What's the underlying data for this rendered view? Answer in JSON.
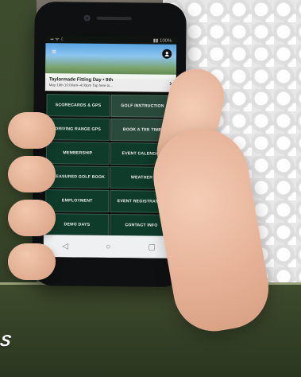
{
  "phone_screen": {
    "status_bar": {
      "left": "•• ᯤ ☾",
      "right": "▮▮ 100%"
    },
    "promo": {
      "title": "Taylormade Fitting Day • 9th",
      "subtitle": "May 19th 10:00am–4:00pm Tap here to...",
      "arrow": "›"
    },
    "tiles": [
      {
        "label": "SCORECARDS & GPS"
      },
      {
        "label": "GOLF INSTRUCTION"
      },
      {
        "label": "DRIVING RANGE GPS"
      },
      {
        "label": "BOOK A TEE TIME"
      },
      {
        "label": "MEMBERSHIP"
      },
      {
        "label": "EVENT CALENDAR"
      },
      {
        "label": "TREASURED GOLF BOOK"
      },
      {
        "label": "WEATHER"
      },
      {
        "label": "EMPLOYMENT"
      },
      {
        "label": "EVENT REGISTRATION"
      },
      {
        "label": "DEMO DAYS"
      },
      {
        "label": "CONTACT INFO"
      }
    ],
    "nav_icons": [
      "back-icon",
      "home-icon",
      "recent-apps-icon"
    ]
  },
  "background_text": {
    "logo_fragment": "S"
  },
  "colors": {
    "tile_green": "#0f3b2b",
    "screen_black": "#0d0f0d",
    "golfball_white": "#e8e8e8",
    "bottom_green": "#2f3c22"
  }
}
